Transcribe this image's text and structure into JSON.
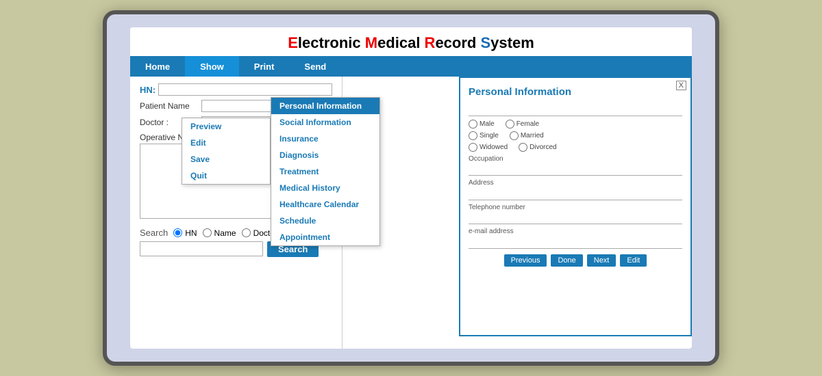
{
  "app": {
    "title": "Electronic Medical Record System",
    "title_parts": [
      {
        "text": "E",
        "color": "red"
      },
      {
        "text": "lectronic "
      },
      {
        "text": "M",
        "color": "red"
      },
      {
        "text": "edical "
      },
      {
        "text": "R",
        "color": "red"
      },
      {
        "text": "ecord "
      },
      {
        "text": "S",
        "color": "blue"
      },
      {
        "text": "ystem"
      }
    ]
  },
  "menubar": {
    "items": [
      {
        "id": "home",
        "label": "Home"
      },
      {
        "id": "show",
        "label": "Show",
        "active": true
      },
      {
        "id": "print",
        "label": "Print"
      },
      {
        "id": "send",
        "label": "Send"
      }
    ]
  },
  "show_dropdown": {
    "items": [
      {
        "id": "preview",
        "label": "Preview"
      },
      {
        "id": "edit",
        "label": "Edit"
      },
      {
        "id": "save",
        "label": "Save"
      },
      {
        "id": "quit",
        "label": "Quit"
      }
    ]
  },
  "show_sub_dropdown": {
    "items": [
      {
        "id": "personal-info",
        "label": "Personal Information",
        "selected": true
      },
      {
        "id": "social-info",
        "label": "Social Information"
      },
      {
        "id": "insurance",
        "label": "Insurance"
      },
      {
        "id": "diagnosis",
        "label": "Diagnosis"
      },
      {
        "id": "treatment",
        "label": "Treatment"
      },
      {
        "id": "medical-history",
        "label": "Medical History"
      },
      {
        "id": "healthcare-calendar",
        "label": "Healthcare Calendar"
      },
      {
        "id": "schedule",
        "label": "Schedule"
      },
      {
        "id": "appointment",
        "label": "Appointment"
      }
    ]
  },
  "left_panel": {
    "hn_label": "HN:",
    "hn_value": "",
    "patient_name_label": "Patient Name",
    "patient_name_value": "",
    "doctor_label": "Doctor :",
    "doctor_value": "",
    "operative_note_label": "Operative Note :"
  },
  "search_section": {
    "label": "Search",
    "radio_options": [
      "HN",
      "Name",
      "Doctor"
    ],
    "selected": "HN",
    "input_value": "",
    "button_label": "Search"
  },
  "personal_info_panel": {
    "title": "Personal Information",
    "close_label": "X",
    "name_label": "",
    "gender_options": [
      "Male",
      "Female"
    ],
    "marital_options": [
      "Single",
      "Married",
      "Widowed",
      "Divorced"
    ],
    "occupation_label": "Occupation",
    "address_label": "Address",
    "telephone_label": "Telephone number",
    "email_label": "e-mail address",
    "buttons": [
      "Previous",
      "Done",
      "Next",
      "Edit"
    ]
  }
}
